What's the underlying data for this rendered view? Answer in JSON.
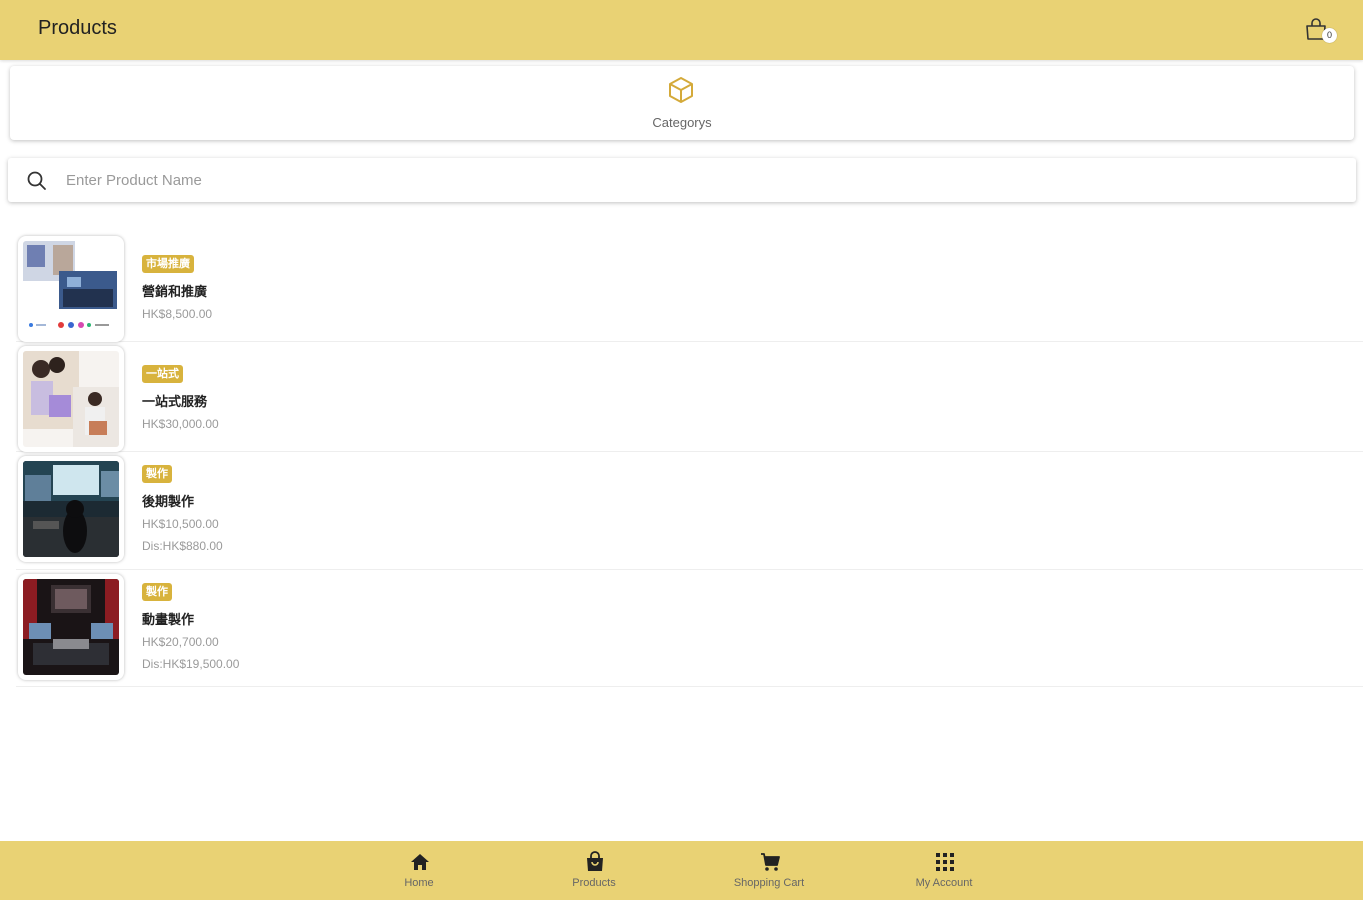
{
  "header": {
    "title": "Products",
    "cart_icon": "shopping-bag-icon",
    "cart_count": "0"
  },
  "category": {
    "label": "Categorys",
    "icon": "cube-icon"
  },
  "search": {
    "placeholder": "Enter Product Name",
    "value": "",
    "icon": "search-icon"
  },
  "products": [
    {
      "tag": "市場推廣",
      "name": "營銷和推廣",
      "price": "HK$8,500.00",
      "discount": ""
    },
    {
      "tag": "一站式",
      "name": "一站式服務",
      "price": "HK$30,000.00",
      "discount": ""
    },
    {
      "tag": "製作",
      "name": "後期製作",
      "price": "HK$10,500.00",
      "discount": "Dis:HK$880.00"
    },
    {
      "tag": "製作",
      "name": "動畫製作",
      "price": "HK$20,700.00",
      "discount": "Dis:HK$19,500.00"
    }
  ],
  "bottom_nav": [
    {
      "label": "Home",
      "icon": "home-icon"
    },
    {
      "label": "Products",
      "icon": "shopping-bag-icon"
    },
    {
      "label": "Shopping Cart",
      "icon": "cart-icon"
    },
    {
      "label": "My Account",
      "icon": "grid-icon"
    }
  ],
  "colors": {
    "accent": "#e9d274",
    "tag": "#d8b33d",
    "icon_gold": "#d4aa3a"
  }
}
